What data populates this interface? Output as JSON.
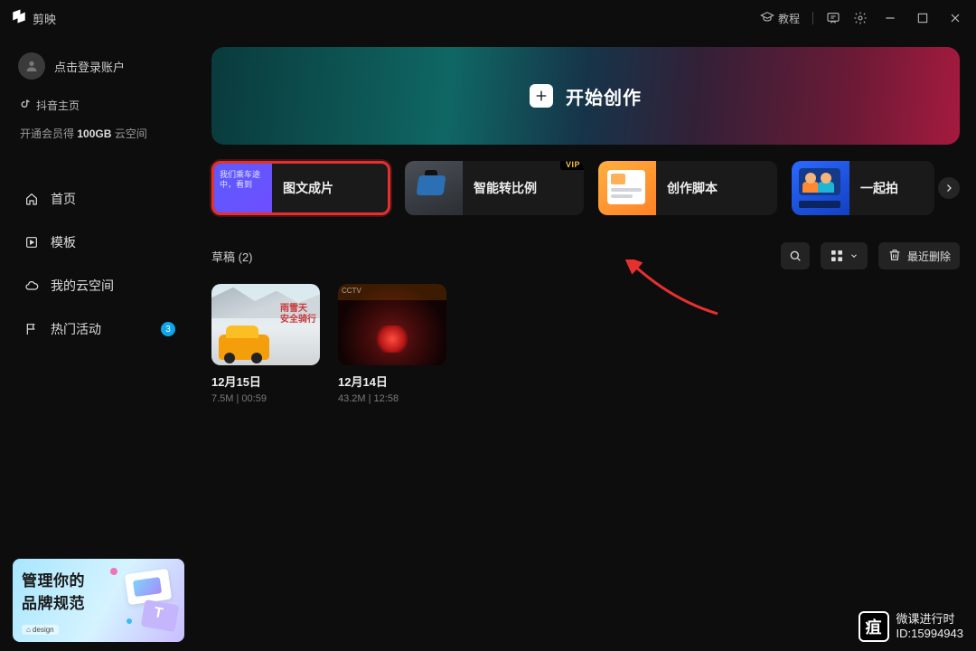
{
  "app": {
    "name": "剪映"
  },
  "titlebar": {
    "tutorial": "教程"
  },
  "sidebar": {
    "login": "点击登录账户",
    "douyin": "抖音主页",
    "promo_before": "开通会员得 ",
    "promo_bold": "100GB",
    "promo_after": " 云空间",
    "nav": {
      "home": "首页",
      "templates": "模板",
      "cloud": "我的云空间",
      "activities": "热门活动",
      "activities_badge": "3"
    },
    "promo_card": {
      "line1": "管理你的",
      "line2": "品牌规范",
      "tag": "⌂ design"
    }
  },
  "hero": {
    "label": "开始创作"
  },
  "features": {
    "f1_label": "图文成片",
    "f1_thumb_caption": "我们乘车途中，看到",
    "f2_label": "智能转比例",
    "f2_vip": "VIP",
    "f3_label": "创作脚本",
    "f4_label": "一起拍"
  },
  "drafts": {
    "header": "草稿 (2)",
    "recent_delete": "最近删除",
    "items": [
      {
        "title": "12月15日",
        "meta": "7.5M | 00:59",
        "thumb_text": "雨雪天\n安全骑行"
      },
      {
        "title": "12月14日",
        "meta": "43.2M | 12:58",
        "logo": "CCTV"
      }
    ]
  },
  "watermark": {
    "line1": "微课进行时",
    "line2": "ID:15994943",
    "icon_text": "疽"
  }
}
